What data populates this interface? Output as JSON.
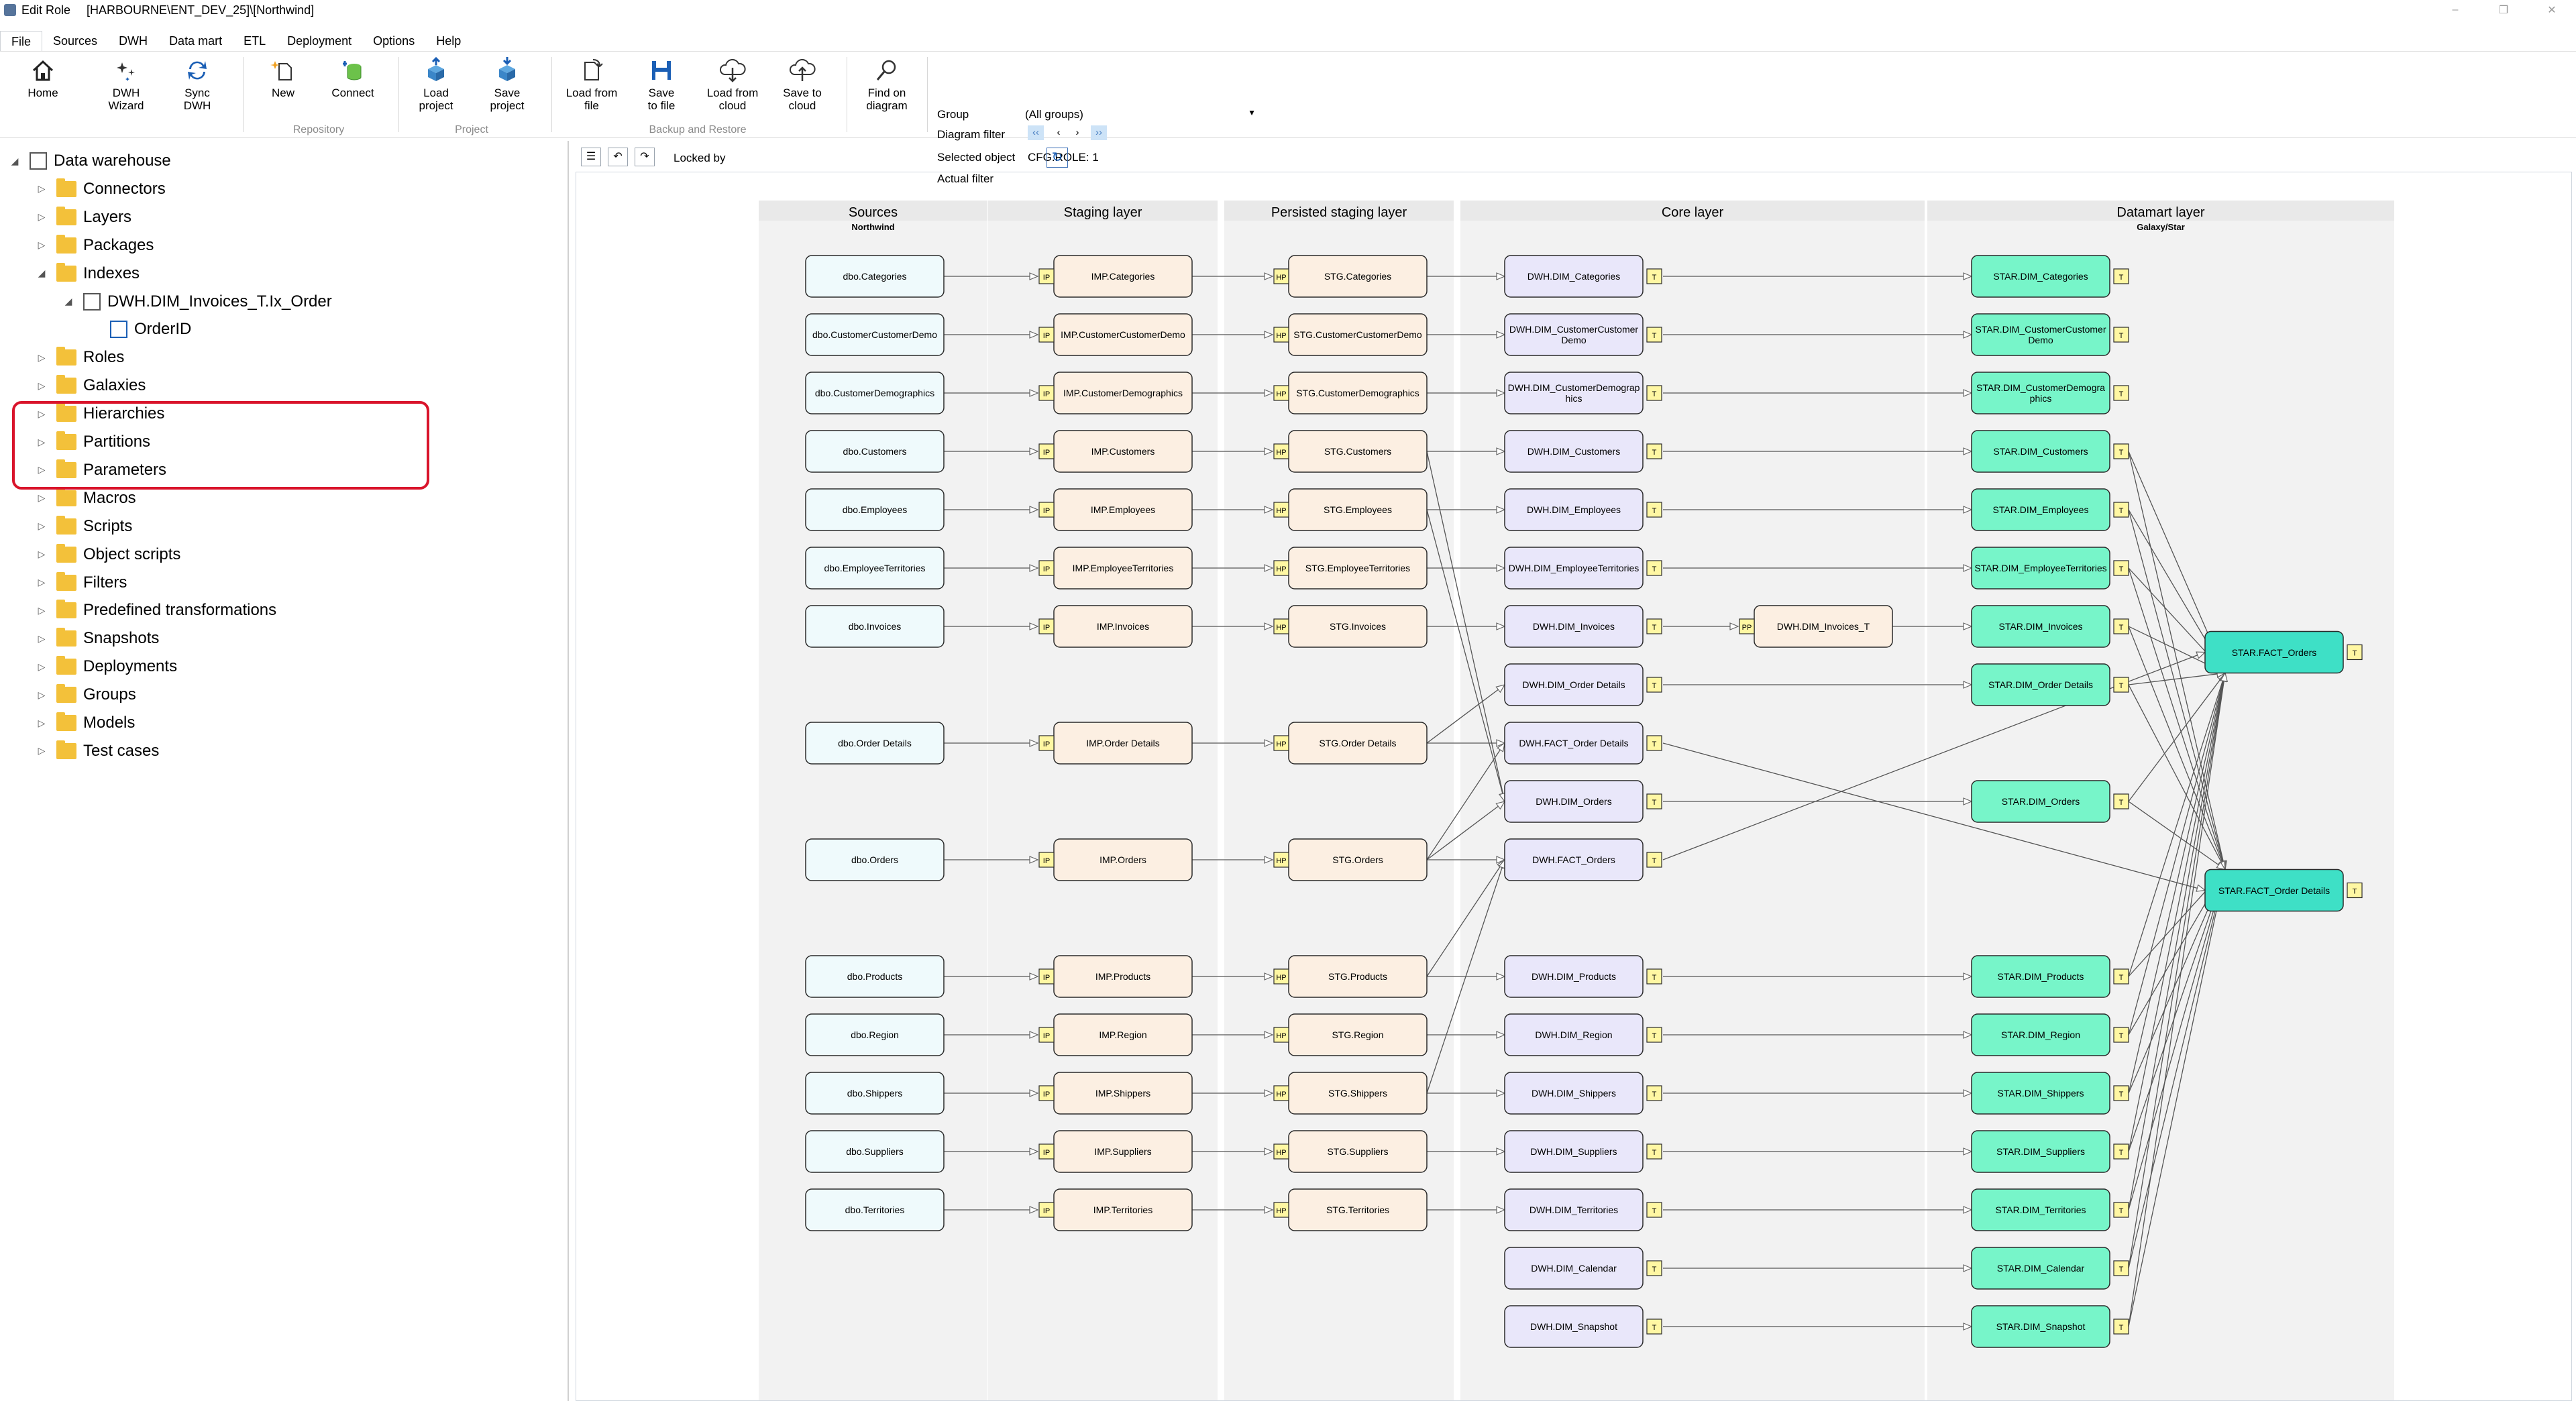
{
  "window": {
    "title_app": "Edit Role",
    "title_path": "[HARBOURNE\\ENT_DEV_25]\\[Northwind]",
    "minimize": "–",
    "maximize": "❐",
    "close": "✕"
  },
  "menu": [
    "File",
    "Sources",
    "DWH",
    "Data mart",
    "ETL",
    "Deployment",
    "Options",
    "Help"
  ],
  "ribbon": {
    "home": "Home",
    "dwh_wizard": [
      "DWH",
      "Wizard"
    ],
    "sync_dwh": [
      "Sync",
      "DWH"
    ],
    "new": "New",
    "connect": "Connect",
    "repository_label": "Repository",
    "load_project": [
      "Load",
      "project"
    ],
    "save_project": [
      "Save",
      "project"
    ],
    "project_label": "Project",
    "load_from_file": [
      "Load from",
      "file"
    ],
    "save_to_file": [
      "Save",
      "to file"
    ],
    "load_from_cloud": [
      "Load from",
      "cloud"
    ],
    "save_to_cloud": [
      "Save to",
      "cloud"
    ],
    "backup_label": "Backup and Restore",
    "find_on_diagram": [
      "Find on",
      "diagram"
    ],
    "group_label": "Group",
    "group_value": "(All groups)",
    "diagram_filter_label": "Diagram filter",
    "diagram_filter_buttons": [
      "‹‹",
      "‹",
      "›",
      "››"
    ],
    "selected_object_label": "Selected object",
    "selected_object_value": "CFG.ROLE: 1",
    "actual_filter_label": "Actual filter"
  },
  "tree": {
    "root": "Data warehouse",
    "items": [
      "Connectors",
      "Layers",
      "Packages",
      "Indexes",
      "Roles",
      "Galaxies",
      "Hierarchies",
      "Partitions",
      "Parameters",
      "Macros",
      "Scripts",
      "Object scripts",
      "Filters",
      "Predefined transformations",
      "Snapshots",
      "Deployments",
      "Groups",
      "Models",
      "Test cases"
    ],
    "index_child": "DWH.DIM_Invoices_T.Ix_Order",
    "index_grandchild": "OrderID"
  },
  "diagram_toolbar": {
    "locked_by": "Locked by",
    "refresh_icon": "↻"
  },
  "diagram": {
    "columns": [
      {
        "title": "Sources",
        "subtitle": "Northwind"
      },
      {
        "title": "Staging layer",
        "subtitle": ""
      },
      {
        "title": "Persisted staging layer",
        "subtitle": ""
      },
      {
        "title": "Core layer",
        "subtitle": ""
      },
      {
        "title": "Datamart layer",
        "subtitle": "Galaxy/Star"
      }
    ],
    "tags": {
      "staging": "IP",
      "persisted": "HP",
      "core": "T",
      "datamart": "T",
      "invoices_t": "PP"
    },
    "rows": [
      {
        "src": "dbo.Categories",
        "imp": "IMP.Categories",
        "stg": "STG.Categories",
        "dwh": "DWH.DIM_Categories",
        "star": "STAR.DIM_Categories"
      },
      {
        "src": "dbo.CustomerCustomerDemo",
        "imp": "IMP.CustomerCustomerDemo",
        "stg": "STG.CustomerCustomerDemo",
        "dwh": "DWH.DIM_CustomerCustomerDemo",
        "star": "STAR.DIM_CustomerCustomerDemo"
      },
      {
        "src": "dbo.CustomerDemographics",
        "imp": "IMP.CustomerDemographics",
        "stg": "STG.CustomerDemographics",
        "dwh": "DWH.DIM_CustomerDemographics",
        "star": "STAR.DIM_CustomerDemographics"
      },
      {
        "src": "dbo.Customers",
        "imp": "IMP.Customers",
        "stg": "STG.Customers",
        "dwh": "DWH.DIM_Customers",
        "star": "STAR.DIM_Customers"
      },
      {
        "src": "dbo.Employees",
        "imp": "IMP.Employees",
        "stg": "STG.Employees",
        "dwh": "DWH.DIM_Employees",
        "star": "STAR.DIM_Employees"
      },
      {
        "src": "dbo.EmployeeTerritories",
        "imp": "IMP.EmployeeTerritories",
        "stg": "STG.EmployeeTerritories",
        "dwh": "DWH.DIM_EmployeeTerritories",
        "star": "STAR.DIM_EmployeeTerritories"
      },
      {
        "src": "dbo.Invoices",
        "imp": "IMP.Invoices",
        "stg": "STG.Invoices",
        "dwh": "DWH.DIM_Invoices",
        "star": "STAR.DIM_Invoices"
      },
      {
        "src": "",
        "imp": "",
        "stg": "",
        "dwh": "DWH.DIM_Order Details",
        "star": "STAR.DIM_Order Details"
      },
      {
        "src": "dbo.Order Details",
        "imp": "IMP.Order Details",
        "stg": "STG.Order Details",
        "dwh": "DWH.FACT_Order Details",
        "star": ""
      },
      {
        "src": "",
        "imp": "",
        "stg": "",
        "dwh": "DWH.DIM_Orders",
        "star": "STAR.DIM_Orders"
      },
      {
        "src": "dbo.Orders",
        "imp": "IMP.Orders",
        "stg": "STG.Orders",
        "dwh": "DWH.FACT_Orders",
        "star": ""
      },
      {
        "src": "",
        "imp": "",
        "stg": "",
        "dwh": "",
        "star": ""
      },
      {
        "src": "dbo.Products",
        "imp": "IMP.Products",
        "stg": "STG.Products",
        "dwh": "DWH.DIM_Products",
        "star": "STAR.DIM_Products"
      },
      {
        "src": "dbo.Region",
        "imp": "IMP.Region",
        "stg": "STG.Region",
        "dwh": "DWH.DIM_Region",
        "star": "STAR.DIM_Region"
      },
      {
        "src": "dbo.Shippers",
        "imp": "IMP.Shippers",
        "stg": "STG.Shippers",
        "dwh": "DWH.DIM_Shippers",
        "star": "STAR.DIM_Shippers"
      },
      {
        "src": "dbo.Suppliers",
        "imp": "IMP.Suppliers",
        "stg": "STG.Suppliers",
        "dwh": "DWH.DIM_Suppliers",
        "star": "STAR.DIM_Suppliers"
      },
      {
        "src": "dbo.Territories",
        "imp": "IMP.Territories",
        "stg": "STG.Territories",
        "dwh": "DWH.DIM_Territories",
        "star": "STAR.DIM_Territories"
      },
      {
        "src": "",
        "imp": "",
        "stg": "",
        "dwh": "DWH.DIM_Calendar",
        "star": "STAR.DIM_Calendar"
      },
      {
        "src": "",
        "imp": "",
        "stg": "",
        "dwh": "DWH.DIM_Snapshot",
        "star": "STAR.DIM_Snapshot"
      }
    ],
    "invoices_t": "DWH.DIM_Invoices_T",
    "facts": [
      "STAR.FACT_Orders",
      "STAR.FACT_Order Details"
    ],
    "colors": {
      "source_fill": "#effafc",
      "stage_fill": "#fcefe2",
      "core_fill": "#e9e7fa",
      "datamart_fill": "#77f5c9",
      "fact_fill": "#3ee0c6",
      "tag_fill": "#fff7a3",
      "column_bg": "#f2f2f2",
      "accent": "#1b5fb5",
      "highlight": "#d9142b"
    }
  }
}
